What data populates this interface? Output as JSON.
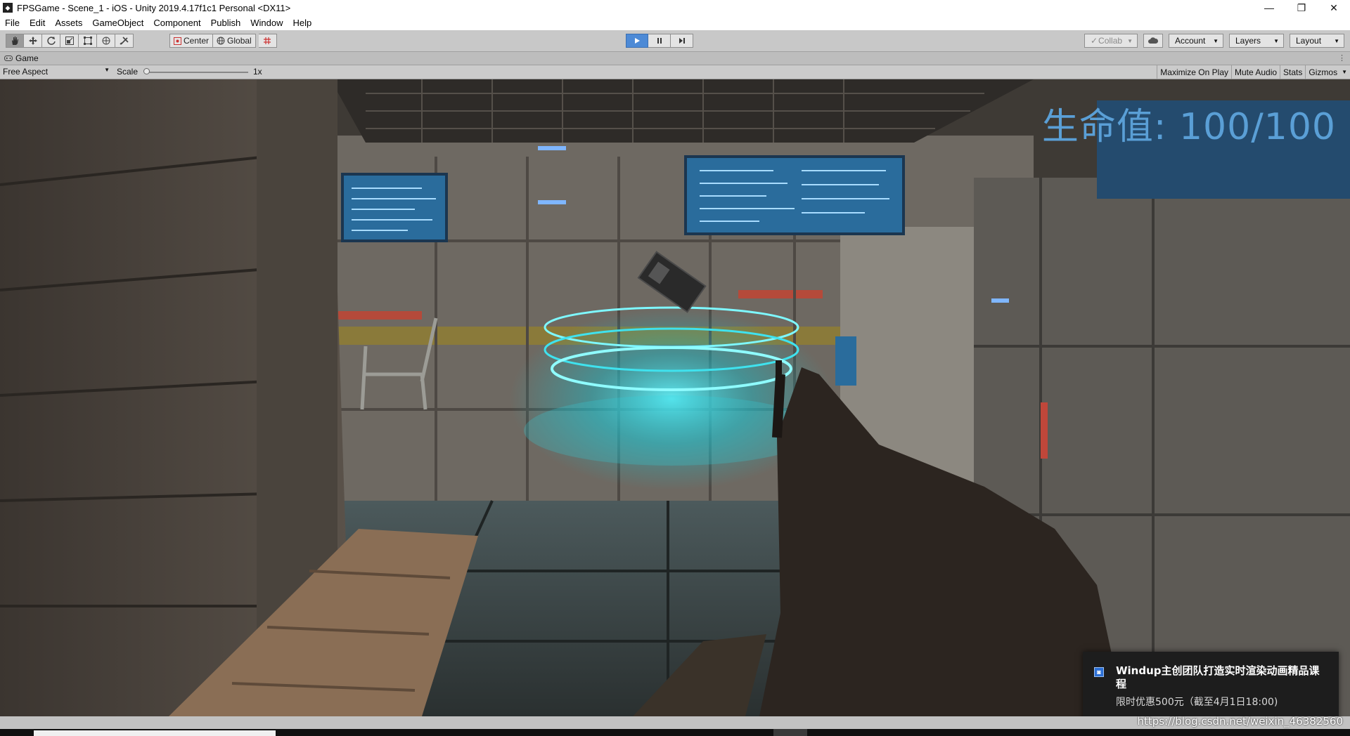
{
  "window": {
    "title": "FPSGame - Scene_1 - iOS - Unity 2019.4.17f1c1 Personal <DX11>",
    "app_icon": "unity-icon",
    "controls": [
      "minimize-icon",
      "restore-icon",
      "close-icon"
    ]
  },
  "menu": [
    "File",
    "Edit",
    "Assets",
    "GameObject",
    "Component",
    "Publish",
    "Window",
    "Help"
  ],
  "toolbar": {
    "tools": [
      "hand-tool-icon",
      "move-tool-icon",
      "rotate-tool-icon",
      "scale-tool-icon",
      "rect-tool-icon",
      "transform-tool-icon",
      "custom-tool-icon"
    ],
    "pivot_label": "Center",
    "space_label": "Global",
    "snap_icon": "grid-snap-icon",
    "collab_label": "Collab",
    "account_label": "Account",
    "layers_label": "Layers",
    "layout_label": "Layout"
  },
  "game_tab": {
    "label": "Game",
    "aspect": "Free Aspect",
    "scale_label": "Scale",
    "scale_value": "1x",
    "scale_fraction": 0.0,
    "maximize_on_play": "Maximize On Play",
    "mute_audio": "Mute Audio",
    "stats": "Stats",
    "gizmos": "Gizmos"
  },
  "hud": {
    "health_text": "生命值: 100/100"
  },
  "notification": {
    "title": "Windup主创团队打造实时渲染动画精品课程",
    "body": "限时优惠500元（截至4月1日18:00)"
  },
  "watermark": "https://blog.csdn.net/weixin_46382560",
  "colors": {
    "accent_play": "#4d8ad6",
    "hud_blue": "#5a9fd6",
    "hologram": "#22d8e6"
  }
}
